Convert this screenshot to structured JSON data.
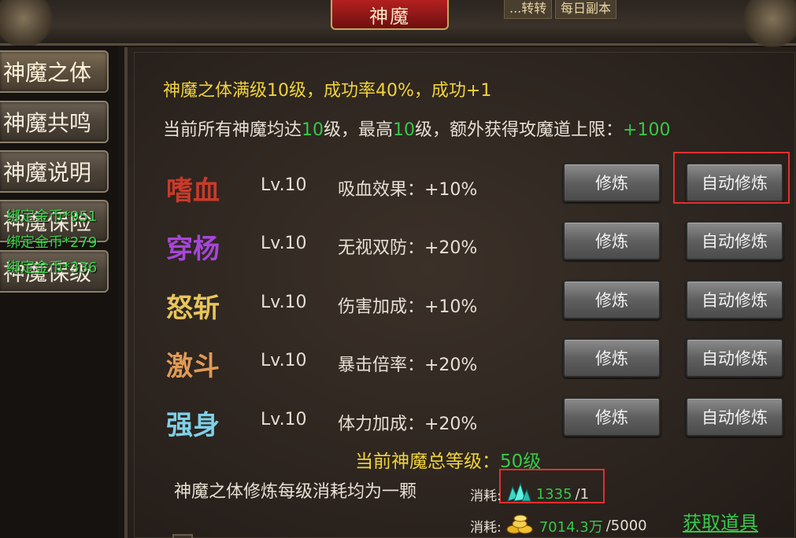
{
  "window": {
    "title": "神魔"
  },
  "top_tags": [
    "...转转",
    "每日副本"
  ],
  "sidebar": {
    "items": [
      {
        "label": "神魔之体",
        "active": true
      },
      {
        "label": "神魔共鸣",
        "active": false
      },
      {
        "label": "神魔说明",
        "active": false
      },
      {
        "label": "神魔保险",
        "active": false
      },
      {
        "label": "神魔保级",
        "active": false
      }
    ],
    "floating_messages": [
      "绑定金币*951",
      "绑定金币*279",
      "绑定金币*336"
    ]
  },
  "info": {
    "line1": "神魔之体满级10级，成功率40%，成功+1",
    "line2_prefix": "当前所有神魔均达",
    "line2_level": "10",
    "line2_mid": "级，最高",
    "line2_max": "10",
    "line2_suffix": "级，额外获得攻魔道上限：",
    "line2_bonus": "+100"
  },
  "attributes": [
    {
      "name": "嗜血",
      "color": "#c93a2a",
      "level": "Lv.10",
      "effect": "吸血效果：+10%",
      "train_label": "修炼",
      "auto_label": "自动修炼"
    },
    {
      "name": "穿杨",
      "color": "#a646d8",
      "level": "Lv.10",
      "effect": "无视双防：+20%",
      "train_label": "修炼",
      "auto_label": "自动修炼"
    },
    {
      "name": "怒斩",
      "color": "#e8c55a",
      "level": "Lv.10",
      "effect": "伤害加成：+10%",
      "train_label": "修炼",
      "auto_label": "自动修炼"
    },
    {
      "name": "激斗",
      "color": "#e09a55",
      "level": "Lv.10",
      "effect": "暴击倍率：+20%",
      "train_label": "修炼",
      "auto_label": "自动修炼"
    },
    {
      "name": "强身",
      "color": "#7fd0e8",
      "level": "Lv.10",
      "effect": "体力加成：+20%",
      "train_label": "修炼",
      "auto_label": "自动修炼"
    }
  ],
  "summary": {
    "total_label": "当前神魔总等级：",
    "total_value": "50级",
    "note": "神魔之体修炼每级消耗均为一颗",
    "cost_label": "消耗:",
    "crystal_have": "1335",
    "crystal_need": "/1",
    "gold_have": "7014.3万",
    "gold_need": "/5000",
    "get_item_label": "获取道具"
  },
  "icons": [
    "crystal-icon",
    "gold-coins-icon"
  ]
}
